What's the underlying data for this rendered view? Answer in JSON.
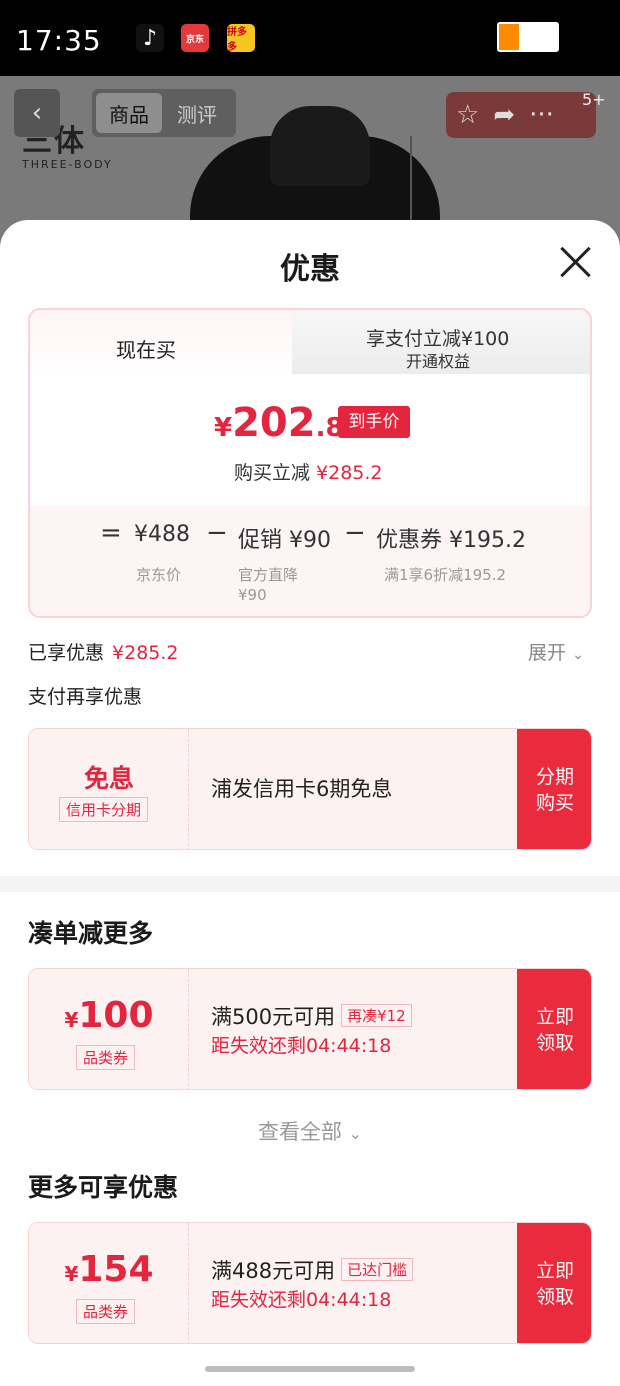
{
  "status_bar": {
    "time": "17:35",
    "apps": [
      "tiktok-icon",
      "jd-icon",
      "pdd-icon"
    ],
    "jd_label": "京东",
    "pdd_label": "拼多多"
  },
  "product_header": {
    "brand_cn": "三体",
    "brand_en": "THREE-BODY",
    "tabs": [
      "商品",
      "测评"
    ],
    "badge": "5+"
  },
  "sheet": {
    "title": "优惠",
    "tabs": {
      "active": "现在买",
      "inactive_line1": "享支付立减¥100",
      "inactive_line2": "开通权益"
    },
    "price": {
      "symbol": "¥",
      "integer": "202",
      "decimal": ".8",
      "tag": "到手价"
    },
    "instant_save": {
      "label": "购买立减",
      "amount": "¥285.2"
    },
    "formula": {
      "eq": "=",
      "jd_price": "¥488",
      "jd_price_label": "京东价",
      "minus": "−",
      "promo": "促销 ¥90",
      "promo_sub1": "官方直降",
      "promo_sub2": "¥90",
      "coupon": "优惠券 ¥195.2",
      "coupon_sub": "满1享6折减195.2"
    },
    "enjoyed": {
      "label": "已享优惠",
      "amount": "¥285.2",
      "expand": "展开"
    },
    "pay_more_title": "支付再享优惠",
    "installment": {
      "big": "免息",
      "label": "信用卡分期",
      "title": "浦发信用卡6期免息",
      "action_l1": "分期",
      "action_l2": "购买"
    },
    "section_more_discount": "凑单减更多",
    "coupon1": {
      "symbol": "¥",
      "amount": "100",
      "type": "品类券",
      "title": "满500元可用",
      "badge": "再凑¥12",
      "timer": "距失效还剩04:44:18",
      "action_l1": "立即",
      "action_l2": "领取"
    },
    "see_all": "查看全部",
    "section_more_enjoy": "更多可享优惠",
    "coupon2": {
      "symbol": "¥",
      "amount": "154",
      "type": "品类券",
      "title": "满488元可用",
      "badge": "已达门槛",
      "timer": "距失效还剩04:44:18",
      "action_l1": "立即",
      "action_l2": "领取"
    }
  },
  "colors": {
    "accent_red": "#e4253e",
    "button_red": "#ea2b3d",
    "card_pink": "#fdf2f2"
  }
}
